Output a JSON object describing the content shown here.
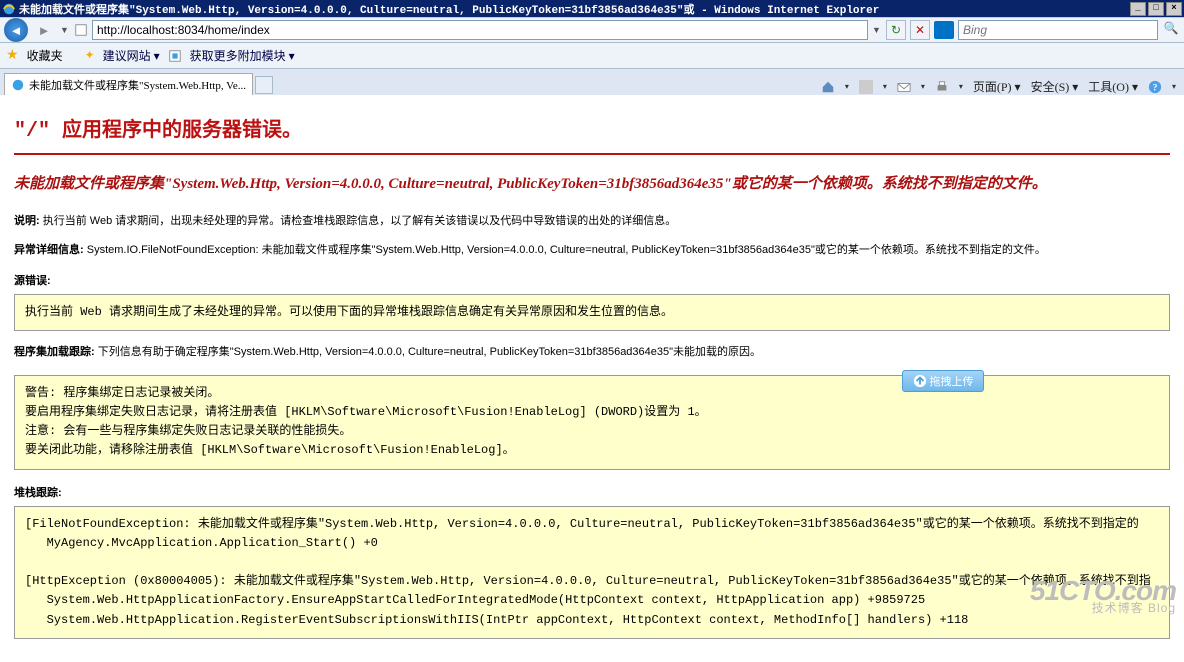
{
  "window": {
    "title": "未能加载文件或程序集\"System.Web.Http, Version=4.0.0.0, Culture=neutral, PublicKeyToken=31bf3856ad364e35\"或 - Windows Internet Explorer"
  },
  "address_bar": {
    "url": "http://localhost:8034/home/index",
    "search_placeholder": "Bing"
  },
  "links_bar": {
    "favorites": "收藏夹",
    "suggested_sites": "建议网站 ▾",
    "get_addons": "获取更多附加模块 ▾"
  },
  "tab": {
    "title": "未能加载文件或程序集\"System.Web.Http, Ve..."
  },
  "toolbar": {
    "page": "页面(P) ▾",
    "safety": "安全(S) ▾",
    "tools": "工具(O) ▾"
  },
  "error_page": {
    "h1": "\"/\" 应用程序中的服务器错误。",
    "h2": "未能加载文件或程序集\"System.Web.Http, Version=4.0.0.0, Culture=neutral, PublicKeyToken=31bf3856ad364e35\"或它的某一个依赖项。系统找不到指定的文件。",
    "desc_label": "说明:",
    "desc_text": " 执行当前 Web 请求期间，出现未经处理的异常。请检查堆栈跟踪信息，以了解有关该错误以及代码中导致错误的出处的详细信息。",
    "exdet_label": "异常详细信息:",
    "exdet_text": " System.IO.FileNotFoundException: 未能加载文件或程序集\"System.Web.Http, Version=4.0.0.0, Culture=neutral, PublicKeyToken=31bf3856ad364e35\"或它的某一个依赖项。系统找不到指定的文件。",
    "source_label": "源错误:",
    "source_box": "执行当前 Web 请求期间生成了未经处理的异常。可以使用下面的异常堆栈跟踪信息确定有关异常原因和发生位置的信息。",
    "asmload_label": "程序集加载跟踪:",
    "asmload_text": " 下列信息有助于确定程序集\"System.Web.Http, Version=4.0.0.0, Culture=neutral, PublicKeyToken=31bf3856ad364e35\"未能加载的原因。",
    "asmload_box": "警告: 程序集绑定日志记录被关闭。\n要启用程序集绑定失败日志记录，请将注册表值 [HKLM\\Software\\Microsoft\\Fusion!EnableLog] (DWORD)设置为 1。\n注意: 会有一些与程序集绑定失败日志记录关联的性能损失。\n要关闭此功能，请移除注册表值 [HKLM\\Software\\Microsoft\\Fusion!EnableLog]。",
    "stack_label": "堆栈跟踪:",
    "stack_box": "[FileNotFoundException: 未能加载文件或程序集\"System.Web.Http, Version=4.0.0.0, Culture=neutral, PublicKeyToken=31bf3856ad364e35\"或它的某一个依赖项。系统找不到指定的\n   MyAgency.MvcApplication.Application_Start() +0\n\n[HttpException (0x80004005): 未能加载文件或程序集\"System.Web.Http, Version=4.0.0.0, Culture=neutral, PublicKeyToken=31bf3856ad364e35\"或它的某一个依赖项。系统找不到指\n   System.Web.HttpApplicationFactory.EnsureAppStartCalledForIntegratedMode(HttpContext context, HttpApplication app) +9859725\n   System.Web.HttpApplication.RegisterEventSubscriptionsWithIIS(IntPtr appContext, HttpContext context, MethodInfo[] handlers) +118"
  },
  "drag_upload": {
    "label": "拖拽上传"
  },
  "watermark": {
    "main": "51CTO.com",
    "sub": "技术博客  Blog"
  }
}
